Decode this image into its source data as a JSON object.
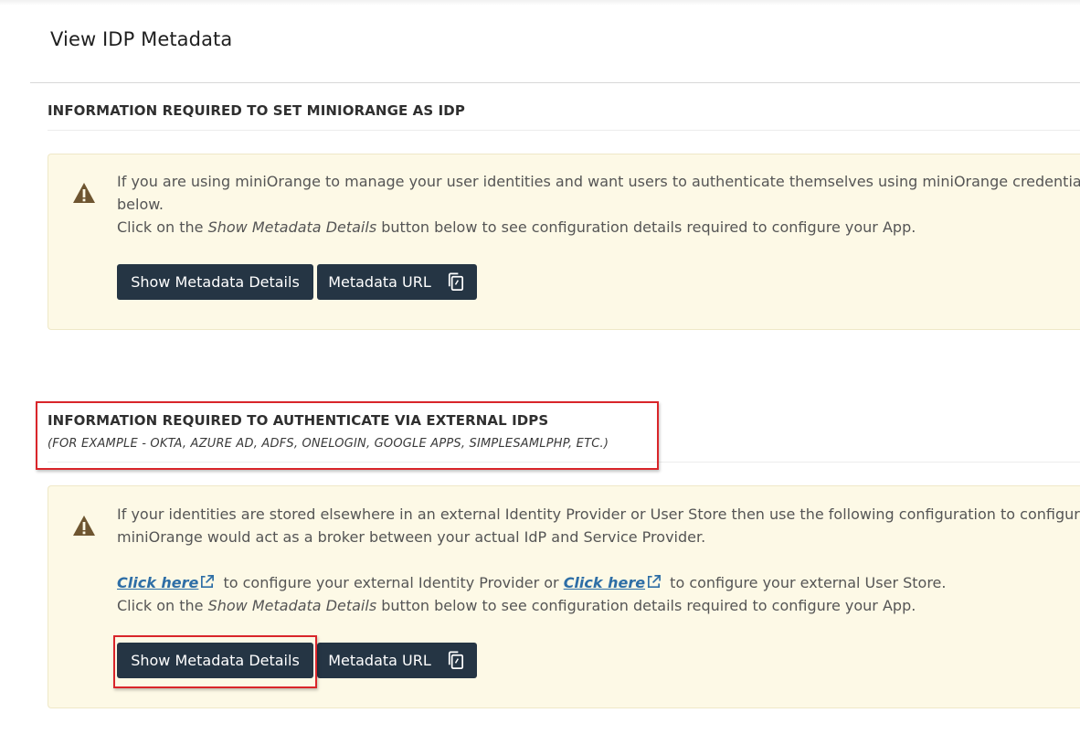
{
  "page": {
    "title": "View IDP Metadata"
  },
  "section1": {
    "heading": "INFORMATION REQUIRED TO SET MINIORANGE AS IDP",
    "line1": "If you are using miniOrange to manage your user identities and want users to authenticate themselves using miniOrange credential",
    "line2": "below.",
    "line3_prefix": "Click on the ",
    "line3_em": "Show Metadata Details",
    "line3_suffix": " button below to see configuration details required to configure your App.",
    "show_button_label": "Show Metadata Details",
    "url_button_label": "Metadata URL"
  },
  "section2": {
    "heading": "INFORMATION REQUIRED TO AUTHENTICATE VIA EXTERNAL IDPS",
    "subheading": "(FOR EXAMPLE - OKTA, AZURE AD, ADFS, ONELOGIN, GOOGLE APPS, SIMPLESAMLPHP, ETC.)",
    "line1": "If your identities are stored elsewhere in an external Identity Provider or User Store then use the following configuration to configure",
    "line2": "miniOrange would act as a broker between your actual IdP and Service Provider.",
    "link1_label": "Click here",
    "link1_suffix": " to configure your external Identity Provider or ",
    "link2_label": "Click here",
    "link2_suffix": " to configure your external User Store.",
    "line4_prefix": "Click on the ",
    "line4_em": "Show Metadata Details",
    "line4_suffix": " button below to see configuration details required to configure your App.",
    "show_button_label": "Show Metadata Details",
    "url_button_label": "Metadata URL"
  },
  "icons": {
    "warning": "warning-triangle-icon",
    "external_link": "external-link-icon",
    "copy": "copy-icon"
  },
  "colors": {
    "button_bg": "#253544",
    "info_bg": "#fdf9e6",
    "link": "#2e6ea6",
    "highlight": "#d9252a"
  }
}
